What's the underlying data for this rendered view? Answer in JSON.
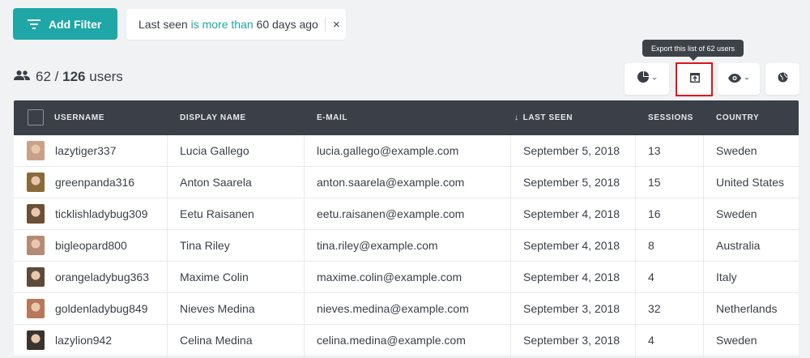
{
  "toolbar": {
    "add_filter_label": "Add Filter",
    "filter": {
      "field": "Last seen",
      "operator": "is more than",
      "value": "60 days ago",
      "remove_symbol": "×"
    }
  },
  "counts": {
    "filtered": "62",
    "separator": "/",
    "total": "126",
    "unit": "users"
  },
  "tooltip": "Export this list of 62 users",
  "table": {
    "columns": [
      "Username",
      "Display Name",
      "E-mail",
      "Last Seen",
      "Sessions",
      "Country"
    ],
    "sort_indicator": "↓",
    "rows": [
      {
        "username": "lazytiger337",
        "display_name": "Lucia Gallego",
        "email": "lucia.gallego@example.com",
        "last_seen": "September 5, 2018",
        "sessions": "13",
        "country": "Sweden",
        "avatar_color": "#c9a188"
      },
      {
        "username": "greenpanda316",
        "display_name": "Anton Saarela",
        "email": "anton.saarela@example.com",
        "last_seen": "September 5, 2018",
        "sessions": "15",
        "country": "United States",
        "avatar_color": "#8a6a3a"
      },
      {
        "username": "ticklishladybug309",
        "display_name": "Eetu Raisanen",
        "email": "eetu.raisanen@example.com",
        "last_seen": "September 4, 2018",
        "sessions": "16",
        "country": "Sweden",
        "avatar_color": "#6b4f36"
      },
      {
        "username": "bigleopard800",
        "display_name": "Tina Riley",
        "email": "tina.riley@example.com",
        "last_seen": "September 4, 2018",
        "sessions": "8",
        "country": "Australia",
        "avatar_color": "#b58b74"
      },
      {
        "username": "orangeladybug363",
        "display_name": "Maxime Colin",
        "email": "maxime.colin@example.com",
        "last_seen": "September 4, 2018",
        "sessions": "4",
        "country": "Italy",
        "avatar_color": "#5e4a3a"
      },
      {
        "username": "goldenladybug849",
        "display_name": "Nieves Medina",
        "email": "nieves.medina@example.com",
        "last_seen": "September 3, 2018",
        "sessions": "32",
        "country": "Netherlands",
        "avatar_color": "#b7775a"
      },
      {
        "username": "lazylion942",
        "display_name": "Celina Medina",
        "email": "celina.medina@example.com",
        "last_seen": "September 3, 2018",
        "sessions": "4",
        "country": "Sweden",
        "avatar_color": "#3a3430"
      }
    ]
  },
  "colors": {
    "accent": "#1fa6a6",
    "header_bg": "#3b4048",
    "highlight": "#e0121b"
  },
  "icons": [
    "filter-lines-icon",
    "users-icon",
    "pie-chart-icon",
    "export-icon",
    "eye-icon",
    "globe-icon",
    "close-icon",
    "sort-down-icon"
  ]
}
